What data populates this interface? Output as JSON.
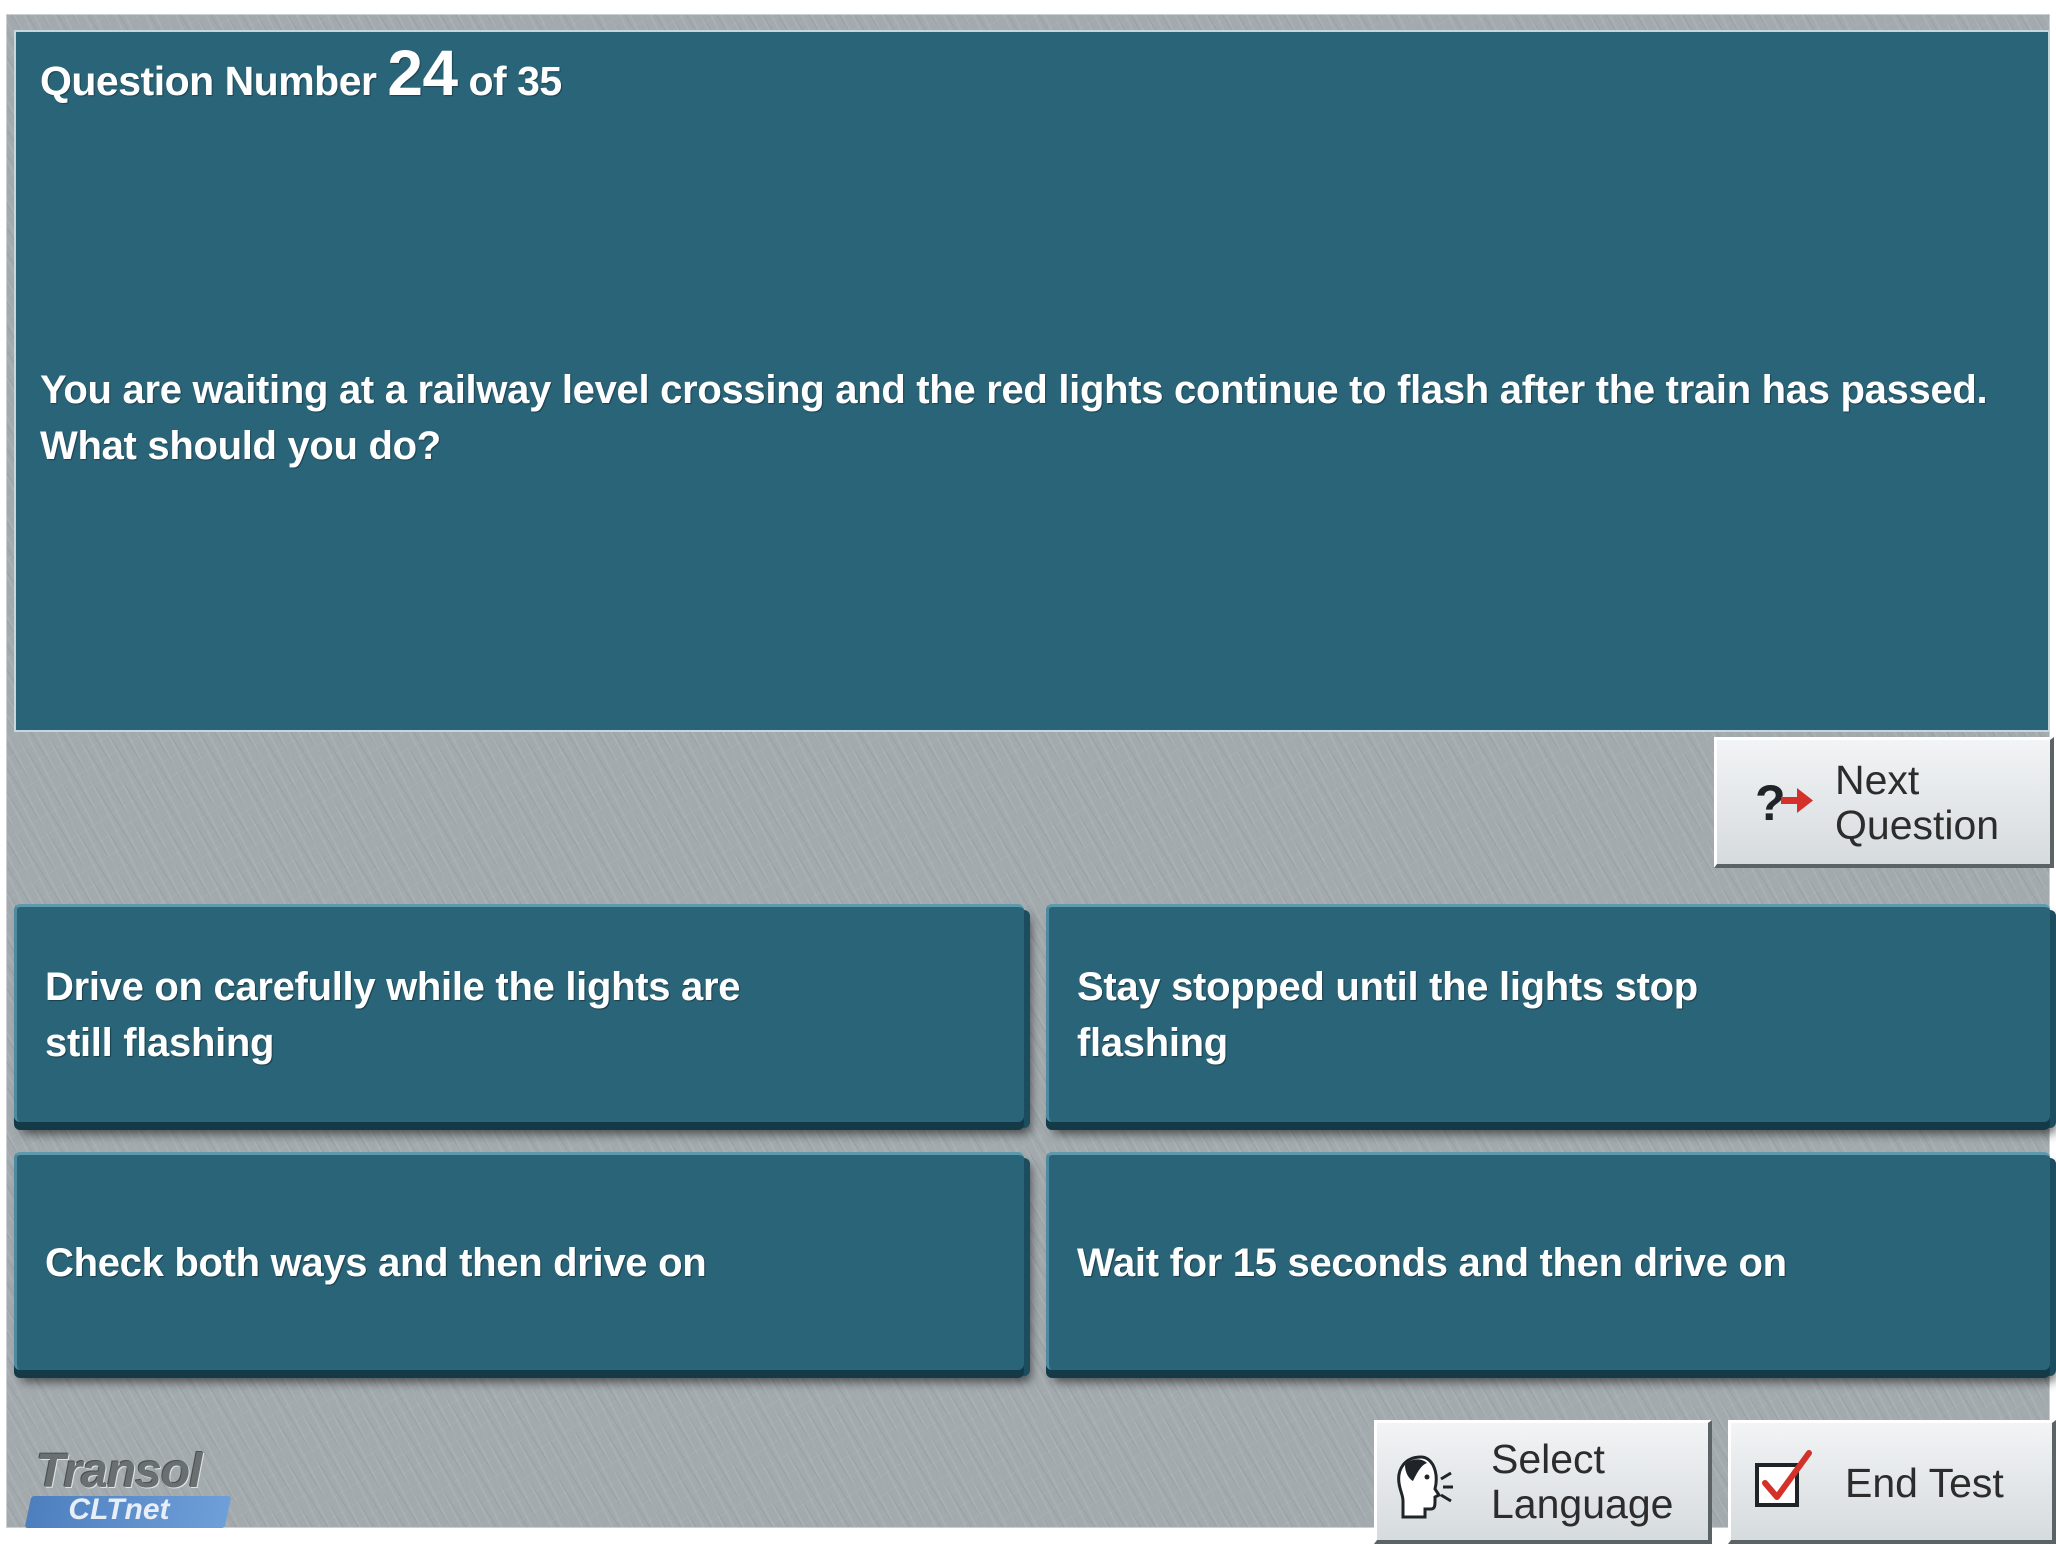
{
  "question": {
    "counter_prefix": "Question Number",
    "number": "24",
    "counter_suffix": "of 35",
    "line1": "You are waiting at a railway level crossing and the red lights continue to flash after the train has passed.",
    "line2": "What should you do?"
  },
  "answers": [
    {
      "label": "Drive on carefully while the lights are\nstill flashing"
    },
    {
      "label": "Stay stopped until the lights stop\nflashing"
    },
    {
      "label": "Check both ways and then drive on"
    },
    {
      "label": "Wait for 15 seconds and then drive on"
    }
  ],
  "controls": {
    "next_question": {
      "line1": "Next",
      "line2": "Question",
      "icon": "question-arrow-icon"
    },
    "select_language": {
      "line1": "Select",
      "line2": "Language",
      "icon": "speaking-head-icon"
    },
    "end_test": {
      "label": "End Test",
      "icon": "checkbox-check-icon"
    }
  },
  "logo": {
    "brand": "Transol",
    "sub": "CLTnet"
  },
  "colors": {
    "panel": "#2a6478",
    "frame": "#a3aaae",
    "button_face": "#e4e8ea",
    "accent_red": "#d4312a"
  }
}
